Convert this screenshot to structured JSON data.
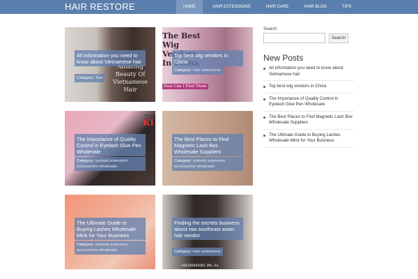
{
  "header": {
    "brand": "HAIR RESTORE",
    "nav": [
      "HOME",
      "HAIR EXTENSIONS",
      "HAIR CARE",
      "HAIR BLOG",
      "TIPS"
    ],
    "active": "HOME",
    "accent": "#5b7fac"
  },
  "posts": [
    {
      "title": "All information you need to know about Vietnamese hair",
      "category_label": "Category:",
      "category": "Tips",
      "image_text": "Amazing Beauty Of Vietnamese Hair"
    },
    {
      "title": "Top best wig vendors in China",
      "category_label": "Category:",
      "category": "Hair extensions",
      "image_text": "The Best Wig Vendors In China",
      "image_subtext": "How Can I Find Them"
    },
    {
      "title": "The Importance of Quality Control in Eyelash Glue Pen Wholesale",
      "category_label": "Category:",
      "category": "eyelash extension accessories wholesale",
      "image_text": "KI",
      "image_subtext": "Bring the"
    },
    {
      "title": "The Best Places to Find Magnetic Lash Box Wholesale Suppliers",
      "category_label": "Category:",
      "category": "eyelash extension accessories wholesale"
    },
    {
      "title": "The Ultimate Guide to Buying Lashes Wholesale Mink for Your Business",
      "category_label": "Category:",
      "category": "eyelash extension accessories wholesale"
    },
    {
      "title": "Finding the secrets business about raw southeast asian hair vendor",
      "category_label": "Category:",
      "category": "Hair extensions",
      "image_text": "+84356665081 (Ms. Sa"
    }
  ],
  "sidebar": {
    "search_label": "Search",
    "search_button": "Search",
    "new_posts_title": "New Posts",
    "new_posts": [
      "All information you need to know about Vietnamese hair",
      "Top best wig vendors in China",
      "The Importance of Quality Control in Eyelash Glue Pen Wholesale",
      "The Best Places to Find Magnetic Lash Box Wholesale Suppliers",
      "The Ultimate Guide to Buying Lashes Wholesale Mink for Your Business"
    ]
  }
}
